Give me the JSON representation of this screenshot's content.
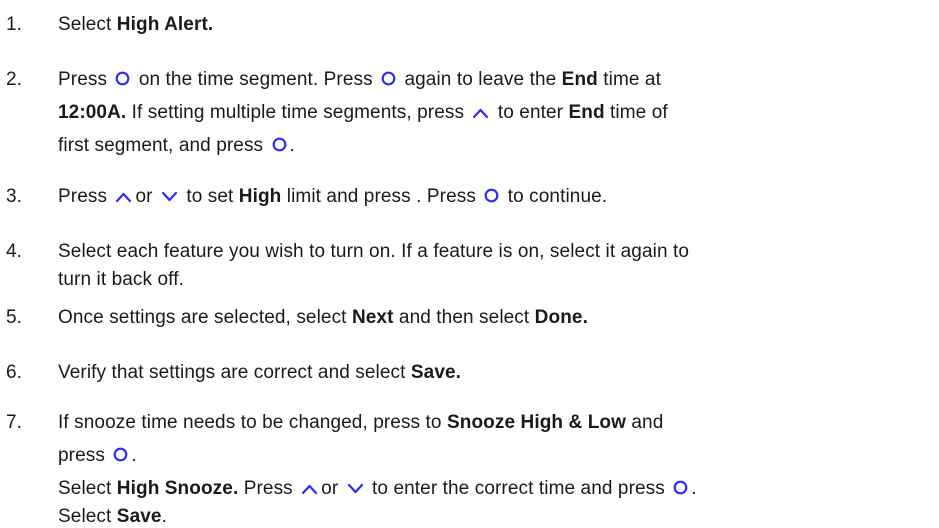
{
  "colors": {
    "text": "#1a1a1a",
    "icon": "#2b2bff"
  },
  "icons": {
    "select": "select-circle-icon",
    "up": "chevron-up-icon",
    "down": "chevron-down-icon"
  },
  "steps": [
    {
      "number": "1.",
      "lines": [
        [
          {
            "t": "Select "
          },
          {
            "t": "High Alert.",
            "b": true
          }
        ]
      ]
    },
    {
      "number": "2.",
      "lines": [
        [
          {
            "t": "Press "
          },
          {
            "icon": "select"
          },
          {
            "t": " on the time segment. Press "
          },
          {
            "icon": "select"
          },
          {
            "t": " again to leave the "
          },
          {
            "t": "End",
            "b": true
          },
          {
            "t": " time at"
          }
        ],
        [
          {
            "t": "12:00A.",
            "b": true
          },
          {
            "t": " If setting multiple time segments, press "
          },
          {
            "icon": "up"
          },
          {
            "t": " to enter "
          },
          {
            "t": "End",
            "b": true
          },
          {
            "t": " time of"
          }
        ],
        [
          {
            "t": "first segment, and press "
          },
          {
            "icon": "select"
          },
          {
            "t": "."
          }
        ]
      ]
    },
    {
      "number": "3.",
      "lines": [
        [
          {
            "t": "Press "
          },
          {
            "icon": "up"
          },
          {
            "t": "or "
          },
          {
            "icon": "down"
          },
          {
            "t": " to set "
          },
          {
            "t": "High",
            "b": true
          },
          {
            "t": " limit and press . Press "
          },
          {
            "icon": "select"
          },
          {
            "t": " to continue."
          }
        ]
      ]
    },
    {
      "number": "4.",
      "lines": [
        [
          {
            "t": "Select each feature you wish to turn on. If a feature is on, select it again to"
          }
        ],
        [
          {
            "t": "turn it back off."
          }
        ]
      ]
    },
    {
      "number": "5.",
      "lines": [
        [
          {
            "t": "Once settings are selected, select "
          },
          {
            "t": "Next",
            "b": true
          },
          {
            "t": " and then select "
          },
          {
            "t": "Done.",
            "b": true
          }
        ]
      ]
    },
    {
      "number": "6.",
      "lines": [
        [
          {
            "t": "Verify that settings are correct and select "
          },
          {
            "t": "Save.",
            "b": true
          }
        ]
      ]
    },
    {
      "number": "7.",
      "lines": [
        [
          {
            "t": "If snooze time needs to be changed, press to "
          },
          {
            "t": "Snooze High & Low",
            "b": true
          },
          {
            "t": " and"
          }
        ],
        [
          {
            "t": "press "
          },
          {
            "icon": "select"
          },
          {
            "t": "."
          }
        ],
        [
          {
            "t": "Select "
          },
          {
            "t": "High Snooze.",
            "b": true
          },
          {
            "t": " Press "
          },
          {
            "icon": "up"
          },
          {
            "t": "or "
          },
          {
            "icon": "down"
          },
          {
            "t": " to enter the correct time and press "
          },
          {
            "icon": "select"
          },
          {
            "t": "."
          }
        ],
        [
          {
            "t": "Select "
          },
          {
            "t": "Save",
            "b": true
          },
          {
            "t": "."
          }
        ]
      ]
    }
  ]
}
